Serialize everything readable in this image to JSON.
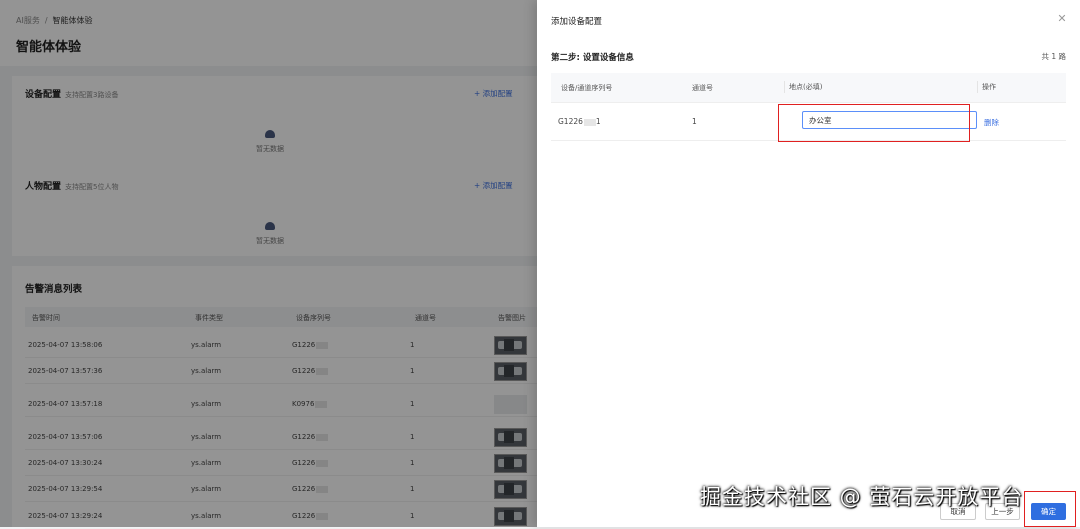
{
  "breadcrumb": {
    "parent": "AI服务",
    "separator": "/",
    "current": "智能体体验"
  },
  "page_title": "智能体体验",
  "device_config": {
    "title": "设备配置",
    "subtitle": "支持配置3路设备",
    "add_label": "+ 添加配置",
    "empty_text": "暂无数据"
  },
  "person_config": {
    "title": "人物配置",
    "subtitle": "支持配置5位人物",
    "add_label": "+ 添加配置",
    "empty_text": "暂无数据"
  },
  "alarm_list": {
    "title": "告警消息列表",
    "columns": [
      "告警时间",
      "事件类型",
      "设备序列号",
      "通道号",
      "告警图片"
    ],
    "rows": [
      {
        "time": "2025-04-07 13:58:06",
        "event": "ys.alarm",
        "serial": "G1226",
        "channel": "1",
        "has_image": true
      },
      {
        "time": "2025-04-07 13:57:36",
        "event": "ys.alarm",
        "serial": "G1226",
        "channel": "1",
        "has_image": true
      },
      {
        "time": "2025-04-07 13:57:18",
        "event": "ys.alarm",
        "serial": "K0976",
        "channel": "1",
        "has_image": false
      },
      {
        "time": "2025-04-07 13:57:06",
        "event": "ys.alarm",
        "serial": "G1226",
        "channel": "1",
        "has_image": true
      },
      {
        "time": "2025-04-07 13:30:24",
        "event": "ys.alarm",
        "serial": "G1226",
        "channel": "1",
        "has_image": true
      },
      {
        "time": "2025-04-07 13:29:54",
        "event": "ys.alarm",
        "serial": "G1226",
        "channel": "1",
        "has_image": true
      },
      {
        "time": "2025-04-07 13:29:24",
        "event": "ys.alarm",
        "serial": "G1226",
        "channel": "1",
        "has_image": true
      }
    ]
  },
  "drawer": {
    "title": "添加设备配置",
    "close_icon": "close-icon",
    "step_title": "第二步: 设置设备信息",
    "total": "共 1 路",
    "columns": {
      "serial": "设备/通道序列号",
      "channel": "通道号",
      "location": "地点(必填)",
      "action": "操作"
    },
    "row": {
      "serial": "G1226",
      "serial_suffix": "1",
      "channel": "1",
      "location_value": "办公室",
      "delete_label": "删除"
    },
    "buttons": {
      "cancel": "取消",
      "prev": "上一步",
      "confirm": "确定"
    }
  },
  "watermark": "掘金技术社区 @ 萤石云开放平台",
  "colors": {
    "accent": "#2f6ee0",
    "highlight_box": "#e02020",
    "mask": "rgba(0,0,0,0.42)"
  }
}
